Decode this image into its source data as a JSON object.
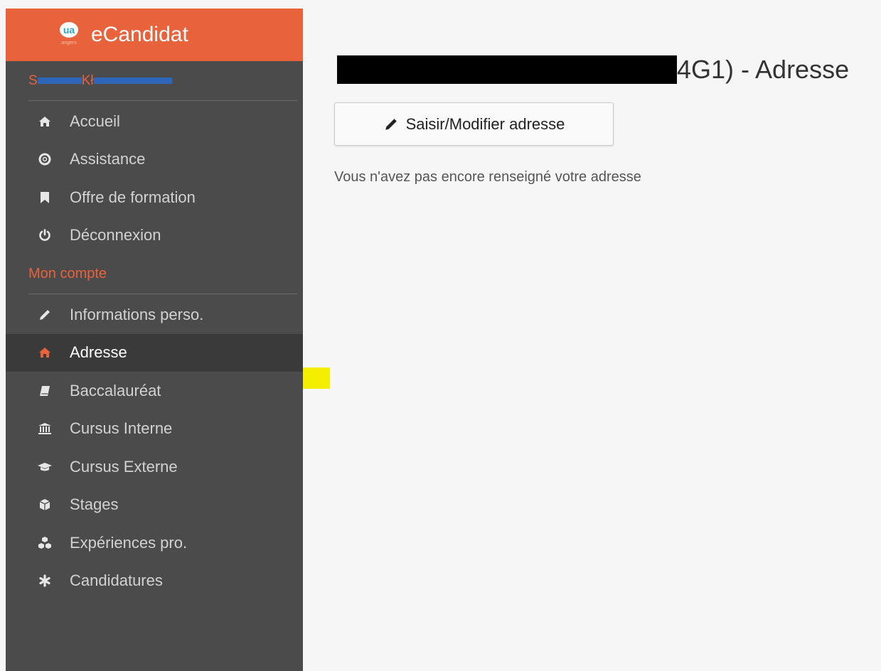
{
  "app": {
    "title": "eCandidat",
    "logo_text": "ua",
    "logo_subtext": "angers"
  },
  "user": {
    "name_prefix": "S",
    "name_visible": "Kł"
  },
  "nav_main": [
    {
      "label": "Accueil",
      "icon": "home-icon"
    },
    {
      "label": "Assistance",
      "icon": "lifebuoy-icon"
    },
    {
      "label": "Offre de formation",
      "icon": "bookmark-icon"
    },
    {
      "label": "Déconnexion",
      "icon": "power-icon"
    }
  ],
  "section_account": "Mon compte",
  "nav_account": [
    {
      "label": "Informations perso.",
      "icon": "pencil-icon",
      "active": false
    },
    {
      "label": "Adresse",
      "icon": "home-icon",
      "active": true
    },
    {
      "label": "Baccalauréat",
      "icon": "book-icon",
      "active": false
    },
    {
      "label": "Cursus Interne",
      "icon": "institution-icon",
      "active": false
    },
    {
      "label": "Cursus Externe",
      "icon": "graduation-cap-icon",
      "active": false
    },
    {
      "label": "Stages",
      "icon": "cube-icon",
      "active": false
    },
    {
      "label": "Expériences pro.",
      "icon": "cubes-icon",
      "active": false
    },
    {
      "label": "Candidatures",
      "icon": "asterisk-icon",
      "active": false
    }
  ],
  "main": {
    "title_suffix": "4G1) - Adresse",
    "edit_button_label": "Saisir/Modifier adresse",
    "empty_message": "Vous n'avez pas encore renseigné votre adresse"
  },
  "colors": {
    "accent": "#e8633b",
    "sidebar_bg": "#4b4b4b",
    "page_bg": "#f6f6f6"
  }
}
